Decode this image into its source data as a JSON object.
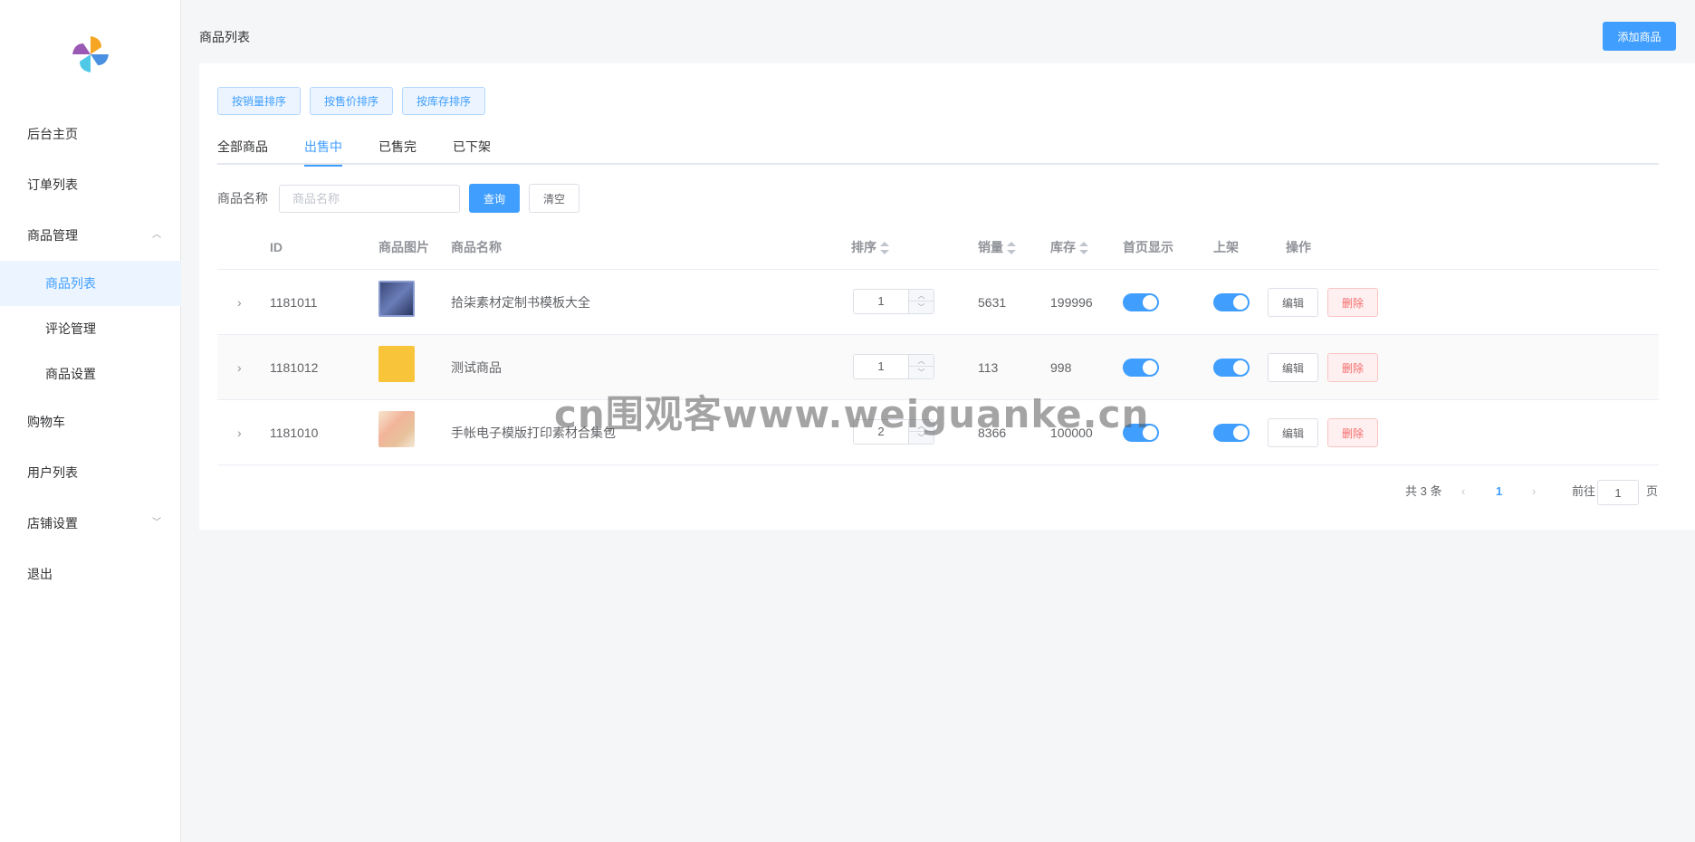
{
  "sidebar": {
    "logo": "pinwheel-logo",
    "items": [
      {
        "label": "后台主页"
      },
      {
        "label": "订单列表"
      },
      {
        "label": "商品管理",
        "expanded": true
      },
      {
        "label": "购物车"
      },
      {
        "label": "用户列表"
      },
      {
        "label": "店铺设置",
        "expanded": false
      },
      {
        "label": "退出"
      }
    ],
    "subitems": [
      {
        "label": "商品列表",
        "active": true
      },
      {
        "label": "评论管理"
      },
      {
        "label": "商品设置"
      }
    ]
  },
  "header": {
    "title": "商品列表",
    "add_button": "添加商品"
  },
  "sort_buttons": [
    "按销量排序",
    "按售价排序",
    "按库存排序"
  ],
  "tabs": [
    {
      "label": "全部商品"
    },
    {
      "label": "出售中",
      "active": true
    },
    {
      "label": "已售完"
    },
    {
      "label": "已下架"
    }
  ],
  "search": {
    "label": "商品名称",
    "placeholder": "商品名称",
    "value": "",
    "query_button": "查询",
    "clear_button": "清空"
  },
  "table": {
    "columns": [
      "ID",
      "商品图片",
      "商品名称",
      "排序",
      "销量",
      "库存",
      "首页显示",
      "上架",
      "操作"
    ],
    "rows": [
      {
        "id": "1181011",
        "name": "拾柒素材定制书模板大全",
        "sort": "1",
        "sales": "5631",
        "stock": "199996",
        "homepage": true,
        "listed": true
      },
      {
        "id": "1181012",
        "name": "测试商品",
        "sort": "1",
        "sales": "113",
        "stock": "998",
        "homepage": true,
        "listed": true
      },
      {
        "id": "1181010",
        "name": "手帐电子模版打印素材合集包",
        "sort": "2",
        "sales": "8366",
        "stock": "100000",
        "homepage": true,
        "listed": true
      }
    ],
    "edit_label": "编辑",
    "delete_label": "删除"
  },
  "pagination": {
    "total": "共 3 条",
    "current": "1",
    "goto_prefix": "前往",
    "goto_value": "1",
    "goto_suffix": "页"
  },
  "watermark": "cn围观客www.weiguanke.cn",
  "colors": {
    "primary": "#409eff",
    "danger": "#f56c6c",
    "sidebar_active_bg": "#ecf5ff"
  }
}
